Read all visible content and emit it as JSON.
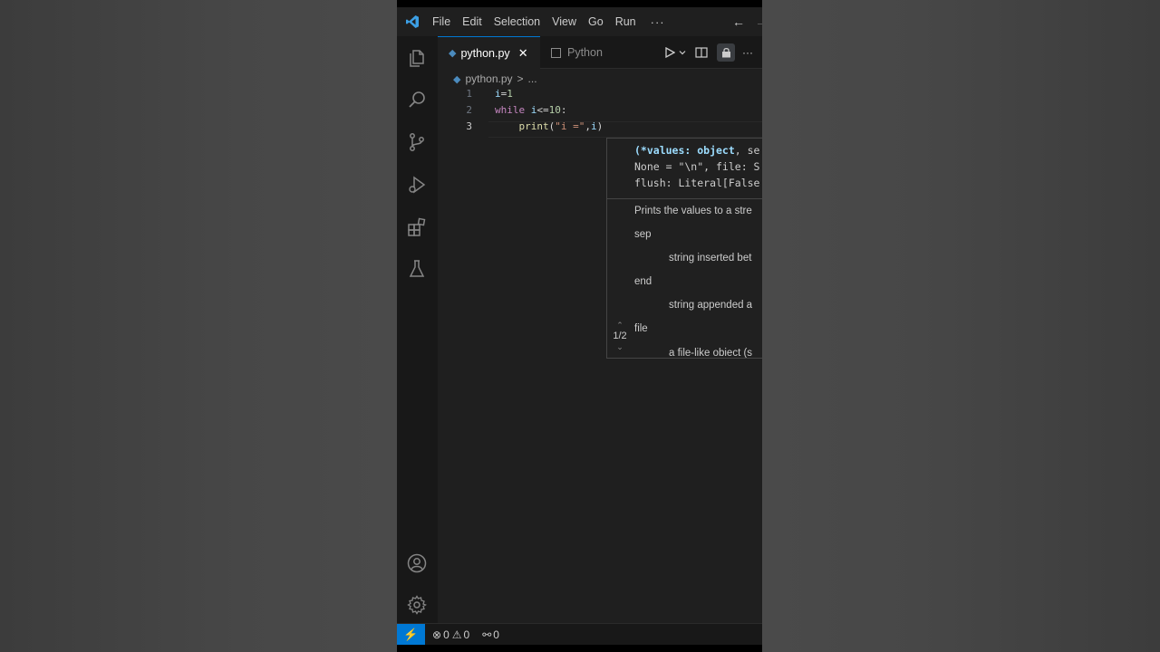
{
  "menu": {
    "items": [
      "File",
      "Edit",
      "Selection",
      "View",
      "Go",
      "Run"
    ],
    "more": "···"
  },
  "nav": {
    "back": "←",
    "forward": "→"
  },
  "activity_bar": {
    "icons": [
      "files-icon",
      "search-icon",
      "source-control-icon",
      "run-debug-icon",
      "extensions-icon",
      "testing-icon"
    ],
    "bottom_icons": [
      "account-icon",
      "settings-gear-icon"
    ]
  },
  "tabs": [
    {
      "label": "python.py",
      "active": true,
      "close": "✕"
    },
    {
      "label": "Python",
      "active": false
    }
  ],
  "tab_actions": {
    "more": "···"
  },
  "breadcrumb": {
    "file": "python.py",
    "sep": ">",
    "more": "..."
  },
  "editor": {
    "lines": [
      {
        "number": "1",
        "tokens": [
          [
            "var",
            "i"
          ],
          [
            "op",
            "="
          ],
          [
            "num",
            "1"
          ]
        ]
      },
      {
        "number": "2",
        "tokens": [
          [
            "kw",
            "while"
          ],
          [
            "op",
            " "
          ],
          [
            "var",
            "i"
          ],
          [
            "op",
            "<="
          ],
          [
            "num",
            "10"
          ],
          [
            "op",
            ":"
          ]
        ]
      },
      {
        "number": "3",
        "tokens": [
          [
            "op",
            "    "
          ],
          [
            "fn",
            "print"
          ],
          [
            "op",
            "("
          ],
          [
            "str",
            "\"i =\""
          ],
          [
            "op",
            ","
          ],
          [
            "var",
            "i"
          ],
          [
            "op",
            ")"
          ]
        ]
      }
    ],
    "active_line": 3
  },
  "hover": {
    "signature": [
      [
        [
          "param",
          "(*values: object"
        ],
        [
          "plain",
          ", se"
        ]
      ],
      [
        [
          "plain",
          "None = \"\\n\", file: S"
        ]
      ],
      [
        [
          "plain",
          "flush: Literal[False"
        ]
      ]
    ],
    "doc": [
      {
        "text": "Prints the values to a stre",
        "indent": false
      },
      {
        "text": "sep",
        "indent": false
      },
      {
        "text": "string inserted bet",
        "indent": true
      },
      {
        "text": "end",
        "indent": false
      },
      {
        "text": "string appended a",
        "indent": true
      },
      {
        "text": "file",
        "indent": false
      },
      {
        "text": "a file-like obiect (s",
        "indent": true
      }
    ],
    "pager": "1/2"
  },
  "status": {
    "remote": "⚡",
    "errors": "0",
    "warnings": "0",
    "ports": "0"
  }
}
